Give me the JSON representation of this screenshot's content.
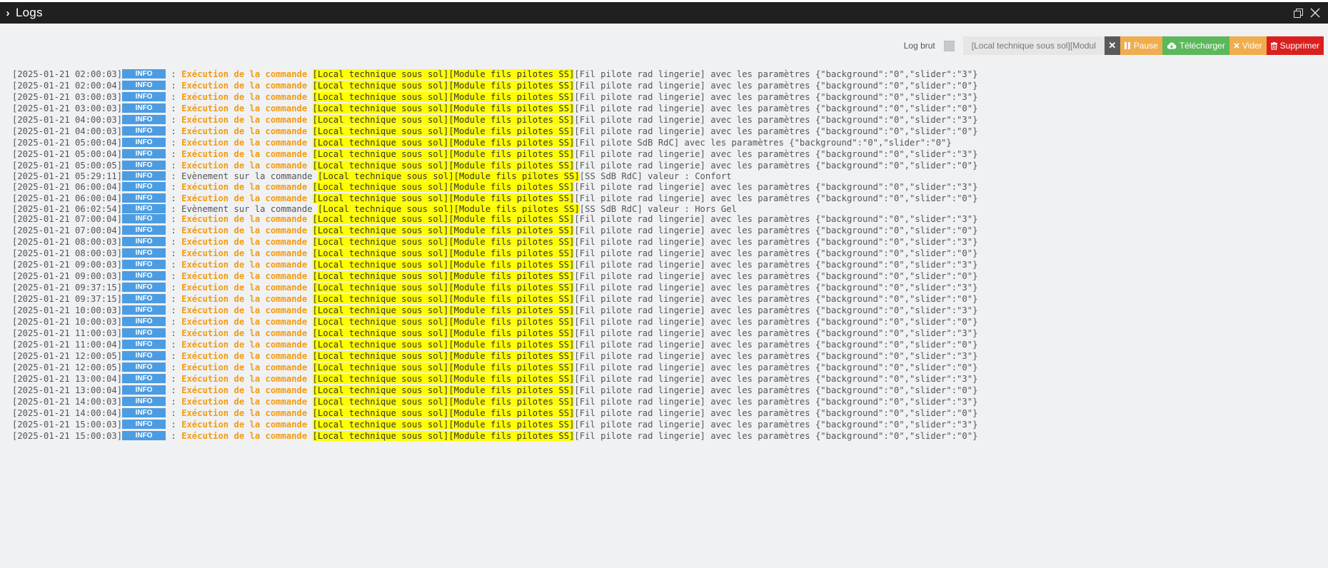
{
  "window": {
    "title": "Logs"
  },
  "toolbar": {
    "log_brut_label": "Log brut",
    "search_value": "[Local technique sous sol][Modul",
    "clear_label": "✕",
    "pause_label": "Pause",
    "download_label": "Télécharger",
    "empty_label": "Vider",
    "delete_label": "Supprimer"
  },
  "colors": {
    "titlebar": "#202020",
    "info_badge": "#4b9ce2",
    "exec_text": "#f39c12",
    "highlight": "#ffff00",
    "pause": "#f0ad4e",
    "download": "#5cb85c",
    "delete": "#d9201e"
  },
  "log": {
    "level": "INFO",
    "sep": " : ",
    "exec_text": "Exécution de la commande ",
    "event_text": "Evènement sur la commande ",
    "highlight": "[Local technique sous sol][Module fils pilotes SS]",
    "lines": [
      {
        "ts": "[2025-01-21 02:00:03]",
        "type": "exec",
        "rest": "[Fil pilote rad lingerie] avec les paramètres {\"background\":\"0\",\"slider\":\"3\"}"
      },
      {
        "ts": "[2025-01-21 02:00:04]",
        "type": "exec",
        "rest": "[Fil pilote rad lingerie] avec les paramètres {\"background\":\"0\",\"slider\":\"0\"}"
      },
      {
        "ts": "[2025-01-21 03:00:03]",
        "type": "exec",
        "rest": "[Fil pilote rad lingerie] avec les paramètres {\"background\":\"0\",\"slider\":\"3\"}"
      },
      {
        "ts": "[2025-01-21 03:00:03]",
        "type": "exec",
        "rest": "[Fil pilote rad lingerie] avec les paramètres {\"background\":\"0\",\"slider\":\"0\"}"
      },
      {
        "ts": "[2025-01-21 04:00:03]",
        "type": "exec",
        "rest": "[Fil pilote rad lingerie] avec les paramètres {\"background\":\"0\",\"slider\":\"3\"}"
      },
      {
        "ts": "[2025-01-21 04:00:03]",
        "type": "exec",
        "rest": "[Fil pilote rad lingerie] avec les paramètres {\"background\":\"0\",\"slider\":\"0\"}"
      },
      {
        "ts": "[2025-01-21 05:00:04]",
        "type": "exec",
        "rest": "[Fil pilote SdB RdC] avec les paramètres {\"background\":\"0\",\"slider\":\"0\"}"
      },
      {
        "ts": "[2025-01-21 05:00:04]",
        "type": "exec",
        "rest": "[Fil pilote rad lingerie] avec les paramètres {\"background\":\"0\",\"slider\":\"3\"}"
      },
      {
        "ts": "[2025-01-21 05:00:05]",
        "type": "exec",
        "rest": "[Fil pilote rad lingerie] avec les paramètres {\"background\":\"0\",\"slider\":\"0\"}"
      },
      {
        "ts": "[2025-01-21 05:29:11]",
        "type": "event",
        "rest": "[SS SdB RdC] valeur : Confort"
      },
      {
        "ts": "[2025-01-21 06:00:04]",
        "type": "exec",
        "rest": "[Fil pilote rad lingerie] avec les paramètres {\"background\":\"0\",\"slider\":\"3\"}"
      },
      {
        "ts": "[2025-01-21 06:00:04]",
        "type": "exec",
        "rest": "[Fil pilote rad lingerie] avec les paramètres {\"background\":\"0\",\"slider\":\"0\"}"
      },
      {
        "ts": "[2025-01-21 06:02:54]",
        "type": "event",
        "rest": "[SS SdB RdC] valeur : Hors Gel"
      },
      {
        "ts": "[2025-01-21 07:00:04]",
        "type": "exec",
        "rest": "[Fil pilote rad lingerie] avec les paramètres {\"background\":\"0\",\"slider\":\"3\"}"
      },
      {
        "ts": "[2025-01-21 07:00:04]",
        "type": "exec",
        "rest": "[Fil pilote rad lingerie] avec les paramètres {\"background\":\"0\",\"slider\":\"0\"}"
      },
      {
        "ts": "[2025-01-21 08:00:03]",
        "type": "exec",
        "rest": "[Fil pilote rad lingerie] avec les paramètres {\"background\":\"0\",\"slider\":\"3\"}"
      },
      {
        "ts": "[2025-01-21 08:00:03]",
        "type": "exec",
        "rest": "[Fil pilote rad lingerie] avec les paramètres {\"background\":\"0\",\"slider\":\"0\"}"
      },
      {
        "ts": "[2025-01-21 09:00:03]",
        "type": "exec",
        "rest": "[Fil pilote rad lingerie] avec les paramètres {\"background\":\"0\",\"slider\":\"3\"}"
      },
      {
        "ts": "[2025-01-21 09:00:03]",
        "type": "exec",
        "rest": "[Fil pilote rad lingerie] avec les paramètres {\"background\":\"0\",\"slider\":\"0\"}"
      },
      {
        "ts": "[2025-01-21 09:37:15]",
        "type": "exec",
        "rest": "[Fil pilote rad lingerie] avec les paramètres {\"background\":\"0\",\"slider\":\"3\"}"
      },
      {
        "ts": "[2025-01-21 09:37:15]",
        "type": "exec",
        "rest": "[Fil pilote rad lingerie] avec les paramètres {\"background\":\"0\",\"slider\":\"0\"}"
      },
      {
        "ts": "[2025-01-21 10:00:03]",
        "type": "exec",
        "rest": "[Fil pilote rad lingerie] avec les paramètres {\"background\":\"0\",\"slider\":\"3\"}"
      },
      {
        "ts": "[2025-01-21 10:00:03]",
        "type": "exec",
        "rest": "[Fil pilote rad lingerie] avec les paramètres {\"background\":\"0\",\"slider\":\"0\"}"
      },
      {
        "ts": "[2025-01-21 11:00:03]",
        "type": "exec",
        "rest": "[Fil pilote rad lingerie] avec les paramètres {\"background\":\"0\",\"slider\":\"3\"}"
      },
      {
        "ts": "[2025-01-21 11:00:04]",
        "type": "exec",
        "rest": "[Fil pilote rad lingerie] avec les paramètres {\"background\":\"0\",\"slider\":\"0\"}"
      },
      {
        "ts": "[2025-01-21 12:00:05]",
        "type": "exec",
        "rest": "[Fil pilote rad lingerie] avec les paramètres {\"background\":\"0\",\"slider\":\"3\"}"
      },
      {
        "ts": "[2025-01-21 12:00:05]",
        "type": "exec",
        "rest": "[Fil pilote rad lingerie] avec les paramètres {\"background\":\"0\",\"slider\":\"0\"}"
      },
      {
        "ts": "[2025-01-21 13:00:04]",
        "type": "exec",
        "rest": "[Fil pilote rad lingerie] avec les paramètres {\"background\":\"0\",\"slider\":\"3\"}"
      },
      {
        "ts": "[2025-01-21 13:00:04]",
        "type": "exec",
        "rest": "[Fil pilote rad lingerie] avec les paramètres {\"background\":\"0\",\"slider\":\"0\"}"
      },
      {
        "ts": "[2025-01-21 14:00:03]",
        "type": "exec",
        "rest": "[Fil pilote rad lingerie] avec les paramètres {\"background\":\"0\",\"slider\":\"3\"}"
      },
      {
        "ts": "[2025-01-21 14:00:04]",
        "type": "exec",
        "rest": "[Fil pilote rad lingerie] avec les paramètres {\"background\":\"0\",\"slider\":\"0\"}"
      },
      {
        "ts": "[2025-01-21 15:00:03]",
        "type": "exec",
        "rest": "[Fil pilote rad lingerie] avec les paramètres {\"background\":\"0\",\"slider\":\"3\"}"
      },
      {
        "ts": "[2025-01-21 15:00:03]",
        "type": "exec",
        "rest": "[Fil pilote rad lingerie] avec les paramètres {\"background\":\"0\",\"slider\":\"0\"}"
      }
    ]
  }
}
